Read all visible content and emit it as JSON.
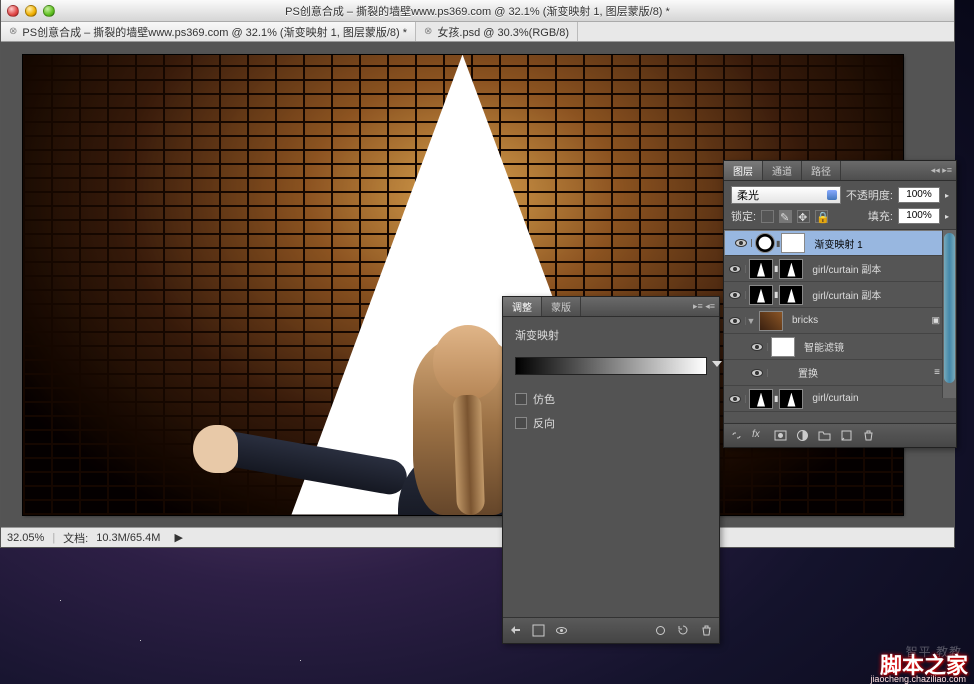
{
  "window": {
    "title": "PS创意合成 – 撕裂的墙壁www.ps369.com @ 32.1% (渐变映射 1, 图层蒙版/8) *"
  },
  "tabs": [
    {
      "close": "⊗",
      "label": "PS创意合成 – 撕裂的墙壁www.ps369.com @ 32.1% (渐变映射 1, 图层蒙版/8) *"
    },
    {
      "close": "⊗",
      "label": "女孩.psd @ 30.3%(RGB/8)"
    }
  ],
  "status": {
    "zoom": "32.05%",
    "doc_label": "文档:",
    "doc_value": "10.3M/65.4M"
  },
  "adjust_panel": {
    "tabs": [
      "调整",
      "蒙版"
    ],
    "title": "渐变映射",
    "dither": "仿色",
    "reverse": "反向"
  },
  "layers_panel": {
    "tabs": [
      "图层",
      "通道",
      "路径"
    ],
    "blend_mode": "柔光",
    "opacity_label": "不透明度:",
    "opacity_value": "100%",
    "lock_label": "锁定:",
    "fill_label": "填充:",
    "fill_value": "100%",
    "layers": [
      {
        "name": "渐变映射 1",
        "selected": true
      },
      {
        "name": "girl/curtain 副本"
      },
      {
        "name": "girl/curtain 副本"
      },
      {
        "name": "bricks"
      },
      {
        "name": "智能滤镜",
        "sub": true
      },
      {
        "name": "置换",
        "sub": true
      },
      {
        "name": "girl/curtain"
      }
    ]
  },
  "watermark": {
    "main": "脚本之家",
    "sub": "jiaocheng.chaziliao.com",
    "faint": "智平 教教"
  }
}
